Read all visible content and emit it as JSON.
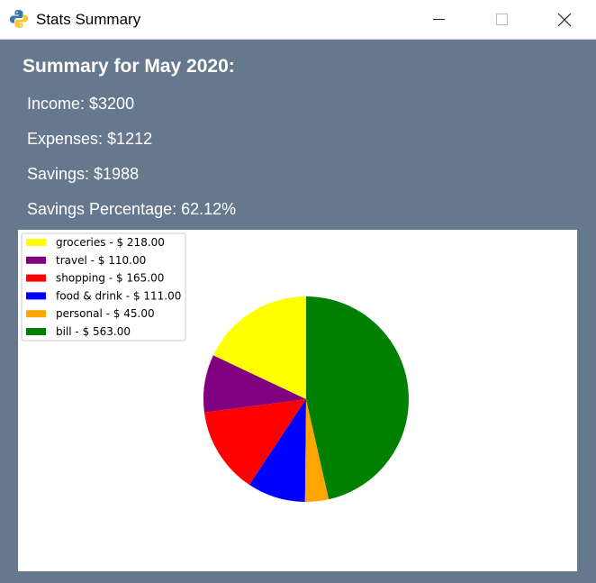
{
  "window": {
    "title": "Stats Summary",
    "icon": "python-icon"
  },
  "summary": {
    "heading": "Summary for May 2020:",
    "income": "Income: $3200",
    "expenses": "Expenses: $1212",
    "savings": "Savings: $1988",
    "savings_percentage": "Savings Percentage: 62.12%"
  },
  "chart_data": {
    "type": "pie",
    "legend_position": "top-left",
    "slices": [
      {
        "label": "groceries - $ 218.00",
        "value": 218.0,
        "color": "#ffff00"
      },
      {
        "label": "travel - $ 110.00",
        "value": 110.0,
        "color": "#800080"
      },
      {
        "label": "shopping - $ 165.00",
        "value": 165.0,
        "color": "#ff0000"
      },
      {
        "label": "food & drink - $ 111.00",
        "value": 111.0,
        "color": "#0000ff"
      },
      {
        "label": "personal - $ 45.00",
        "value": 45.0,
        "color": "#ffa500"
      },
      {
        "label": "bill - $ 563.00",
        "value": 563.0,
        "color": "#008000"
      }
    ]
  },
  "colors": {
    "background": "#66788d",
    "panel": "#ffffff",
    "text": "#ffffff"
  }
}
